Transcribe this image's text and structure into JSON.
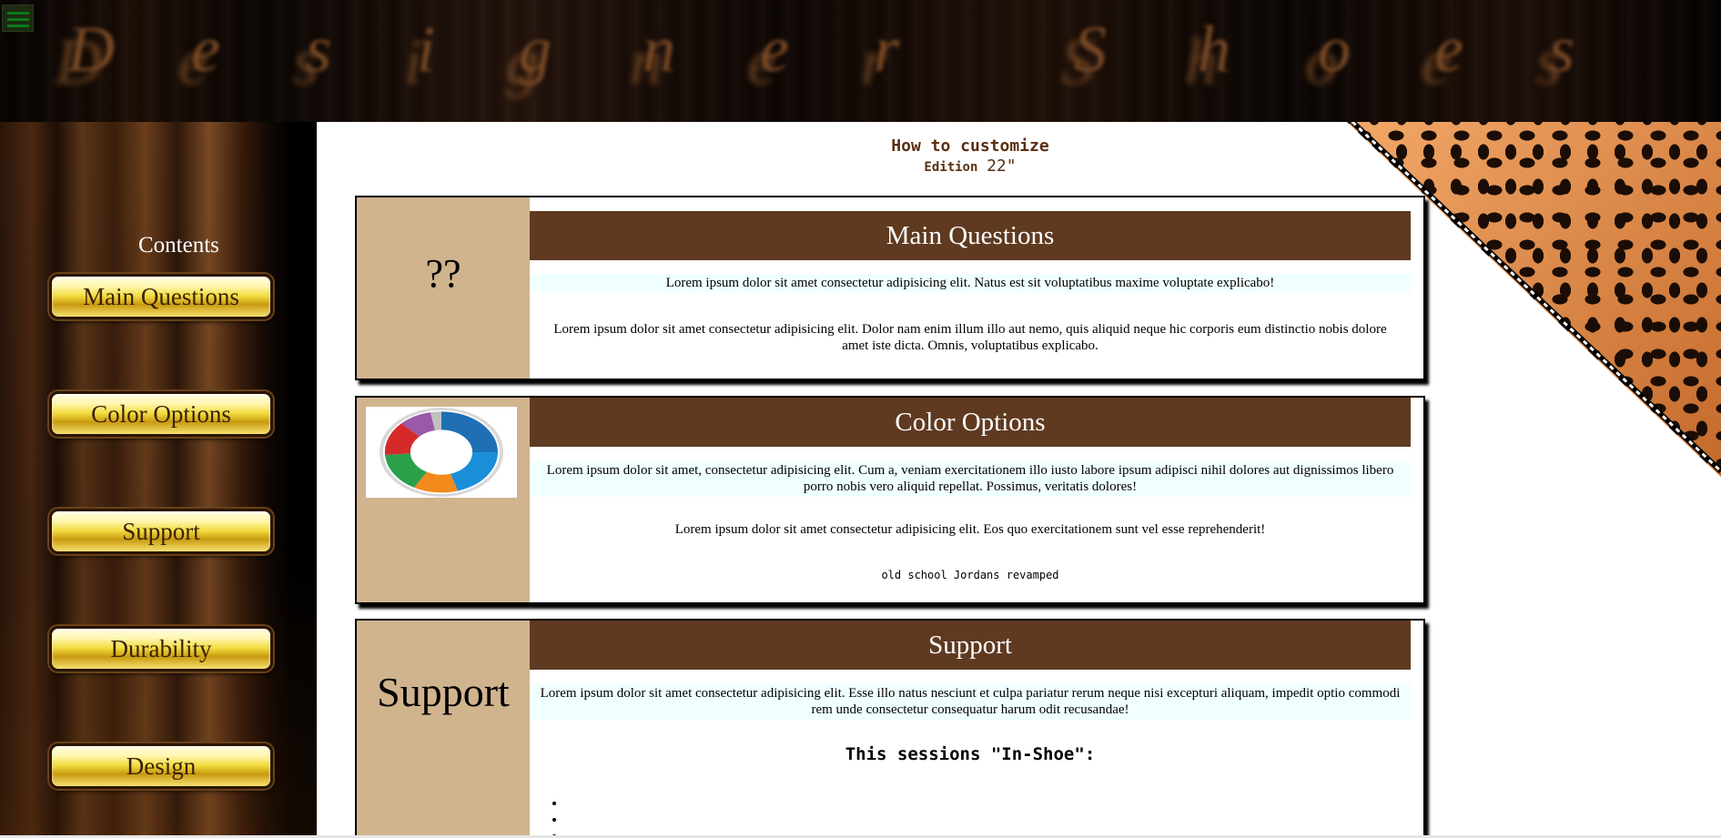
{
  "header": {
    "menu_icon": "hamburger-icon",
    "title_letters": [
      "D",
      "e",
      "s",
      "i",
      "g",
      "n",
      "e",
      "r",
      "S",
      "h",
      "o",
      "e",
      "s"
    ]
  },
  "sidebar": {
    "heading": "Contents",
    "items": [
      {
        "label": "Main Questions"
      },
      {
        "label": "Color Options"
      },
      {
        "label": "Support"
      },
      {
        "label": "Durability"
      },
      {
        "label": "Design"
      }
    ]
  },
  "main": {
    "title": "How to customize",
    "edition_label": "Edition",
    "edition_number": "22\""
  },
  "sections": [
    {
      "side_text": "??",
      "heading": "Main Questions",
      "lead": "Lorem ipsum dolor sit amet consectetur adipisicing elit. Natus est sit voluptatibus maxime voluptate explicabo!",
      "body": "Lorem ipsum dolor sit amet consectetur adipisicing elit. Dolor nam enim illum illo aut nemo, quis aliquid neque hic corporis eum distinctio nobis dolore amet iste dicta. Omnis, voluptatibus explicabo."
    },
    {
      "side_image": "color-wheel-image",
      "heading": "Color Options",
      "lead": "Lorem ipsum dolor sit amet, consectetur adipisicing elit. Cum a, veniam exercitationem illo iusto labore ipsum adipisci nihil dolores aut dignissimos libero porro nobis vero aliquid repellat. Possimus, veritatis dolores!",
      "body": "Lorem ipsum dolor sit amet consectetur adipisicing elit. Eos quo exercitationem sunt vel esse reprehenderit!",
      "caption": "old school Jordans revamped"
    },
    {
      "side_text": "Support",
      "heading": "Support",
      "lead": "Lorem ipsum dolor sit amet consectetur adipisicing elit. Esse illo natus nesciunt et culpa pariatur rerum neque nisi excepturi aliquam, impedit optio commodi rem unde consectetur consequatur harum odit recusandae!",
      "subheading": "This sessions \"In-Shoe\":"
    }
  ],
  "colors": {
    "header_bg": "#0d0603",
    "card_header": "#5f3a21",
    "card_side": "#d0b48e",
    "lead_bg": "#f0ffff",
    "title_text": "#5a2e12",
    "button_gold": "#f3dc40"
  }
}
